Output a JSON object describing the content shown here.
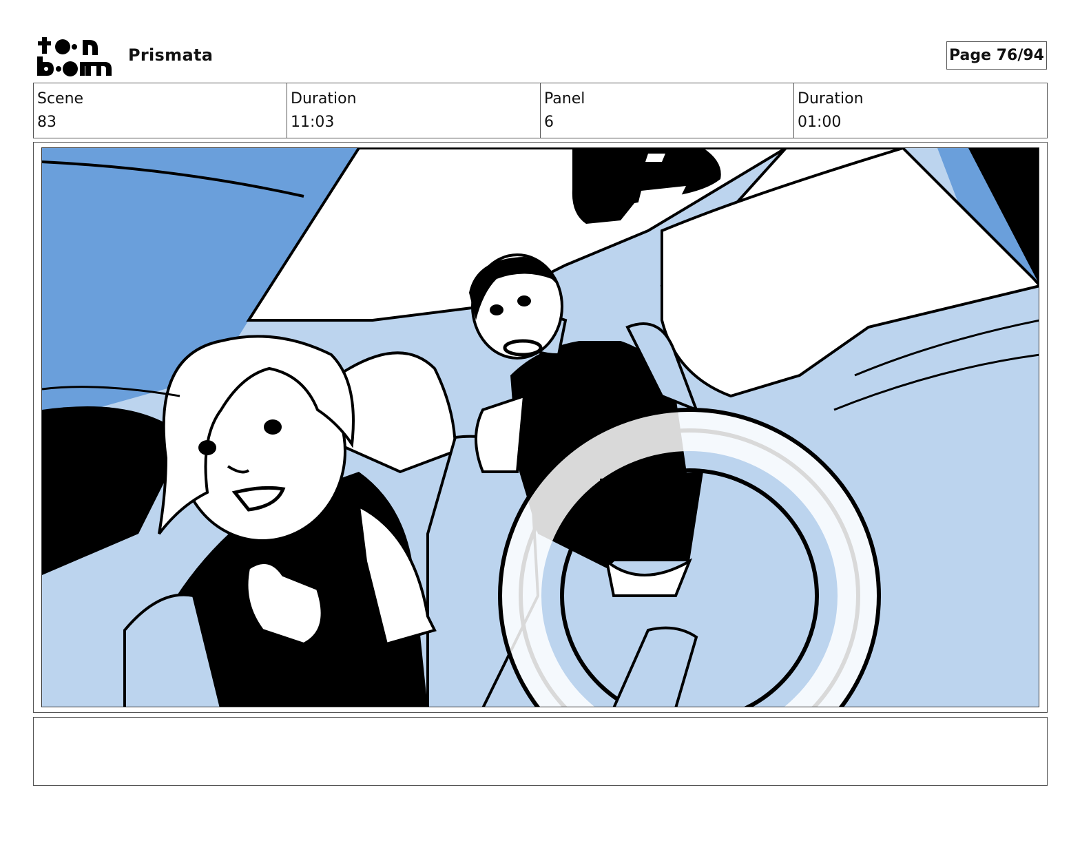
{
  "header": {
    "logo_name": "toon-boom-logo",
    "project_title": "Prismata",
    "page_indicator": "Page 76/94"
  },
  "info": {
    "scene_label": "Scene",
    "scene_value": "83",
    "scene_duration_label": "Duration",
    "scene_duration_value": "11:03",
    "panel_label": "Panel",
    "panel_value": "6",
    "panel_duration_label": "Duration",
    "panel_duration_value": "01:00"
  },
  "panel": {
    "colors": {
      "mid_blue": "#6a9fdb",
      "light_blue": "#bcd4ee",
      "ink": "#000000",
      "paper": "#ffffff"
    }
  },
  "notes": {
    "text": ""
  }
}
